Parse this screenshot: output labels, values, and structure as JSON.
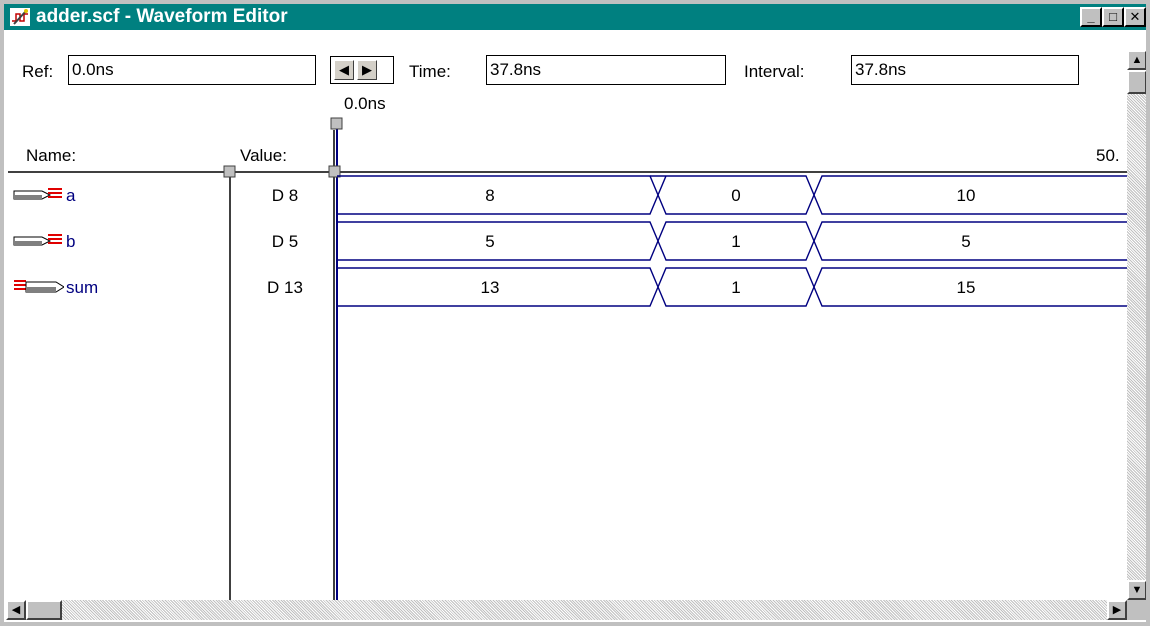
{
  "window": {
    "title": "adder.scf - Waveform Editor",
    "colors": {
      "titlebar": "#008080",
      "signal_name": "#000080",
      "waveform": "#000080"
    }
  },
  "title_buttons": {
    "minimize": "_",
    "maximize": "□",
    "close": "✕"
  },
  "toolbar": {
    "ref_label": "Ref:",
    "ref_value": "0.0ns",
    "time_label": "Time:",
    "time_value": "37.8ns",
    "interval_label": "Interval:",
    "interval_value": "37.8ns",
    "left_arrow": "◀",
    "right_arrow": "▶"
  },
  "timeline": {
    "cursor_time": "0.0ns",
    "end_tick": "50."
  },
  "columns": {
    "name": "Name:",
    "value": "Value:"
  },
  "signals": [
    {
      "name": "a",
      "value": "D 8",
      "icon": "input-pin-icon",
      "segments": [
        "8",
        "0",
        "10"
      ]
    },
    {
      "name": "b",
      "value": "D 5",
      "icon": "input-pin-icon",
      "segments": [
        "5",
        "1",
        "5"
      ]
    },
    {
      "name": "sum",
      "value": "D 13",
      "icon": "output-pin-icon",
      "segments": [
        "13",
        "1",
        "15"
      ]
    }
  ]
}
